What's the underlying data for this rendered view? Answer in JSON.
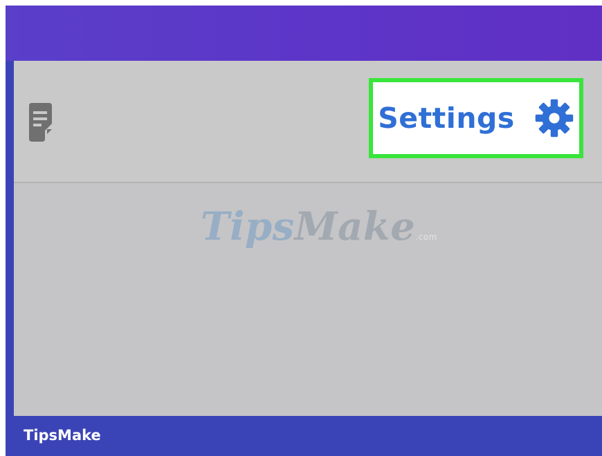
{
  "toolbar": {
    "notes_icon": "note-icon",
    "settings_label": "Settings",
    "settings_icon": "gear-icon"
  },
  "watermark": {
    "part1": "Tips",
    "part2": "Make",
    "tld": ".com"
  },
  "footer": {
    "brand": "TipsMake"
  },
  "colors": {
    "top_bar": "#5b37c8",
    "toolbar_bg": "#c9c9c9",
    "content_bg": "#c5c5c7",
    "settings_text": "#2f6fd6",
    "highlight_border": "#39e43b",
    "frame": "#3b44b6"
  }
}
